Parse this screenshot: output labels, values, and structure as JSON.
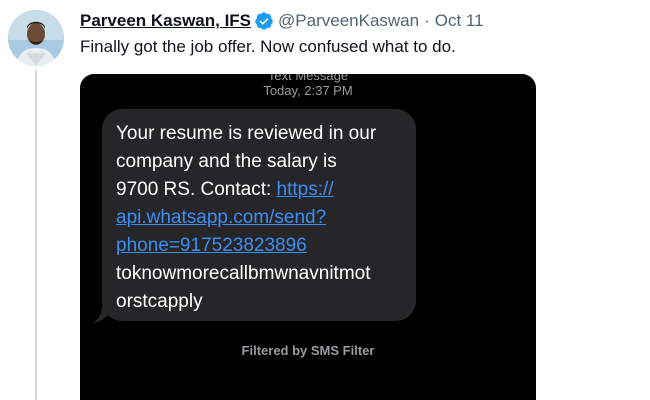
{
  "tweet": {
    "display_name": "Parveen Kaswan, IFS",
    "handle": "@ParveenKaswan",
    "separator": "·",
    "date": "Oct 11",
    "text": "Finally got the job offer. Now confused what to do.",
    "verified_icon": "verified-badge-icon",
    "avatar_icon": "user-avatar"
  },
  "sms": {
    "header_title": "Text Message",
    "header_time": "Today, 2:37 PM",
    "message_line_1": "Your resume is reviewed in our",
    "message_line_2": "company and the salary is",
    "message_line_3_text": "9700 RS. Contact: ",
    "link_part_1": "https://",
    "link_part_2": "api.whatsapp.com/send?",
    "link_part_3": "phone=917523823896",
    "message_line_7": "toknowmorecallbmwnavnitmot",
    "message_line_8": "orstcapply",
    "filter_note": "Filtered by SMS Filter"
  },
  "colors": {
    "verified": "#1d9bf0",
    "link": "#3b8ef5",
    "bubble": "#262629"
  }
}
